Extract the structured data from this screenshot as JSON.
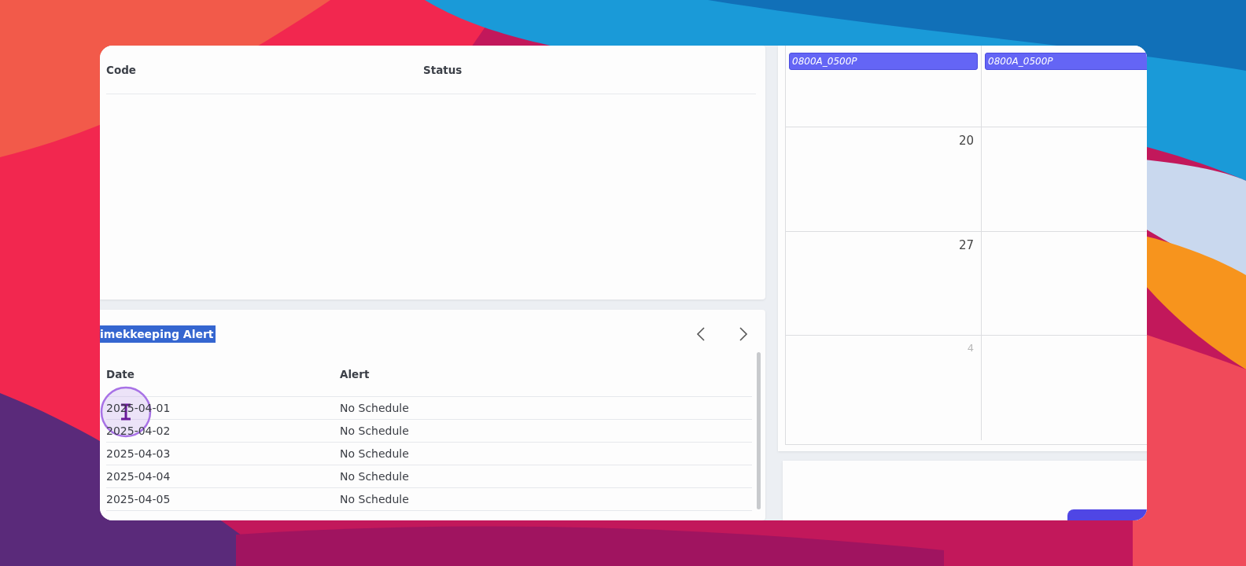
{
  "codes_table": {
    "columns": [
      "Code",
      "Status"
    ]
  },
  "alerts_panel": {
    "title": "imekkeeping Alert",
    "title_selected": true,
    "columns": [
      "Date",
      "Alert"
    ],
    "rows": [
      {
        "date": "2025-04-01",
        "alert": "No Schedule"
      },
      {
        "date": "2025-04-02",
        "alert": "No Schedule"
      },
      {
        "date": "2025-04-03",
        "alert": "No Schedule"
      },
      {
        "date": "2025-04-04",
        "alert": "No Schedule"
      },
      {
        "date": "2025-04-05",
        "alert": "No Schedule"
      }
    ]
  },
  "calendar": {
    "weeks": [
      {
        "cells": [
          {
            "events": [
              "0800A_0500P"
            ]
          },
          {
            "events": [
              "0800A_0500P"
            ]
          }
        ]
      },
      {
        "cells": [
          {
            "day": "20",
            "other_month": false
          },
          {}
        ]
      },
      {
        "cells": [
          {
            "day": "27",
            "other_month": false
          },
          {}
        ]
      },
      {
        "cells": [
          {
            "day": "4",
            "other_month": true
          },
          {}
        ]
      }
    ]
  }
}
